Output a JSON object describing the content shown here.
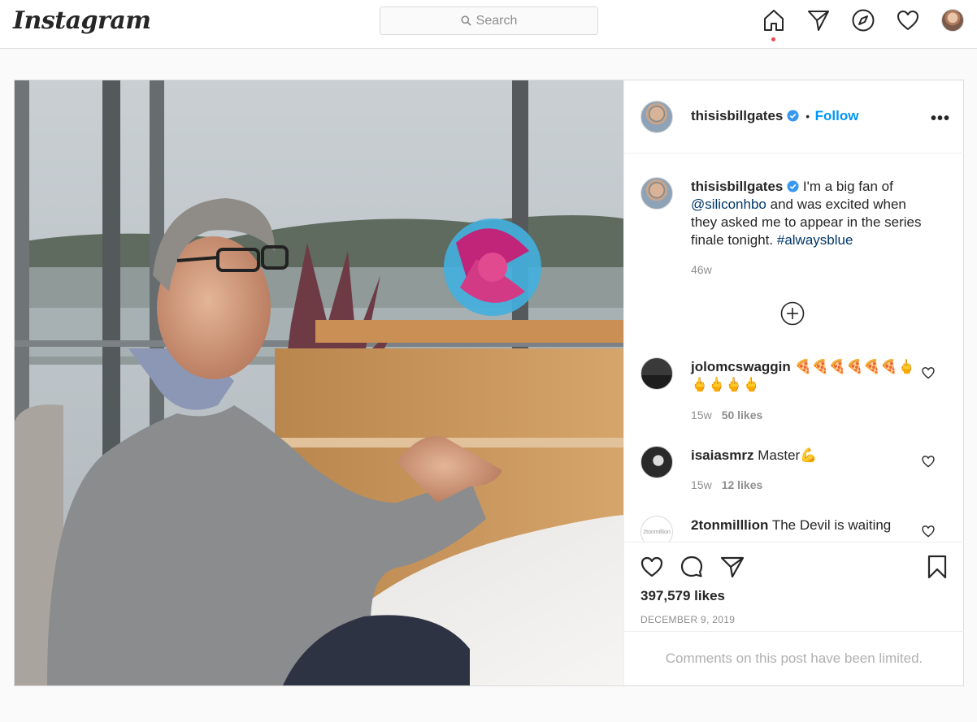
{
  "app": {
    "logo": "Instagram"
  },
  "search": {
    "placeholder": "Search"
  },
  "nav": {
    "icons": [
      "home-icon",
      "direct-icon",
      "explore-icon",
      "activity-icon",
      "profile-avatar"
    ],
    "active_dot_color": "#ed4956"
  },
  "post": {
    "author": "thisisbillgates",
    "follow_label": "Follow",
    "separator": "•",
    "more_label": "•••",
    "caption": {
      "username": "thisisbillgates",
      "text1": "I'm a big fan of",
      "mention": "@siliconhbo",
      "text2": "and was excited when they asked me to appear in the series finale tonight.",
      "hashtag": "#alwaysblue",
      "age": "46w"
    },
    "comments": [
      {
        "username": "jolomcswaggin",
        "text": "🍕🍕🍕🍕🍕🍕🖕🖕🖕🖕🖕",
        "age": "15w",
        "likes": "50 likes"
      },
      {
        "username": "isaiasmrz",
        "text": "Master💪",
        "age": "15w",
        "likes": "12 likes"
      },
      {
        "username": "2tonmilllion",
        "text": "The Devil is waiting",
        "avatar_text": "2tonmillion"
      }
    ],
    "likes": "397,579 likes",
    "date": "DECEMBER 9, 2019",
    "comments_limited": "Comments on this post have been limited."
  },
  "colors": {
    "link": "#0095f6",
    "mention": "#00376b",
    "muted": "#8e8e8e",
    "border": "#dbdbdb"
  }
}
